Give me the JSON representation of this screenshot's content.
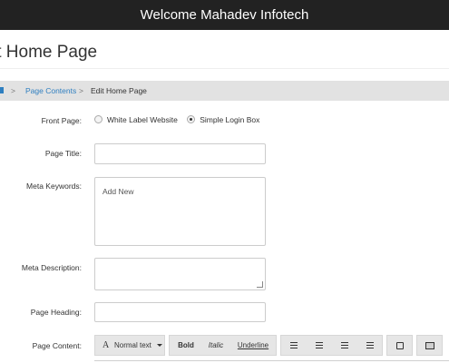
{
  "header": {
    "welcome": "Welcome",
    "brand": "Mahadev Infotech"
  },
  "page_title": "it Home Page",
  "breadcrumb": {
    "sep": ">",
    "link": "Page Contents",
    "current": "Edit Home Page"
  },
  "form": {
    "front_page_label": "Front Page:",
    "front_page_options": [
      "White Label Website",
      "Simple Login Box"
    ],
    "front_page_selected": "Simple Login Box",
    "page_title_label": "Page Title:",
    "page_title_value": "",
    "meta_keywords_label": "Meta Keywords:",
    "meta_keywords_value": "Add New",
    "meta_description_label": "Meta Description:",
    "meta_description_value": "",
    "page_heading_label": "Page Heading:",
    "page_heading_value": "",
    "page_content_label": "Page Content:"
  },
  "editor_toolbar": {
    "format_icon": "A",
    "format_label": "Normal text",
    "bold": "Bold",
    "italic": "Italic",
    "underline": "Underline",
    "list_icons": [
      "unordered-list-icon",
      "ordered-list-icon",
      "outdent-icon",
      "indent-icon"
    ],
    "link_icon": "share-icon",
    "image_icon": "image-icon"
  }
}
